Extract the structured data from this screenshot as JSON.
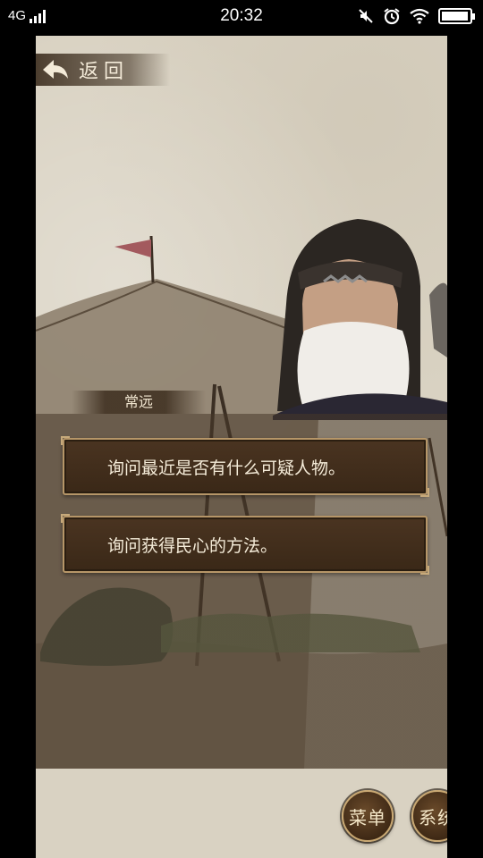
{
  "status_bar": {
    "network": "4G",
    "time": "20:32",
    "battery_level": 0.95,
    "icons": [
      "signal-icon",
      "mute-icon",
      "alarm-icon",
      "wifi-icon",
      "battery-icon"
    ]
  },
  "nav": {
    "back_label": "返回",
    "back_icon": "back-arrow-icon"
  },
  "dialog": {
    "speaker": "常远",
    "choices": [
      {
        "text": "询问最近是否有什么可疑人物。"
      },
      {
        "text": "询问获得民心的方法。"
      }
    ]
  },
  "buttons": {
    "menu": "菜单",
    "system": "系统"
  },
  "colors": {
    "panel": "#3a2817",
    "border": "#b69668",
    "text": "#f5ecd9"
  }
}
